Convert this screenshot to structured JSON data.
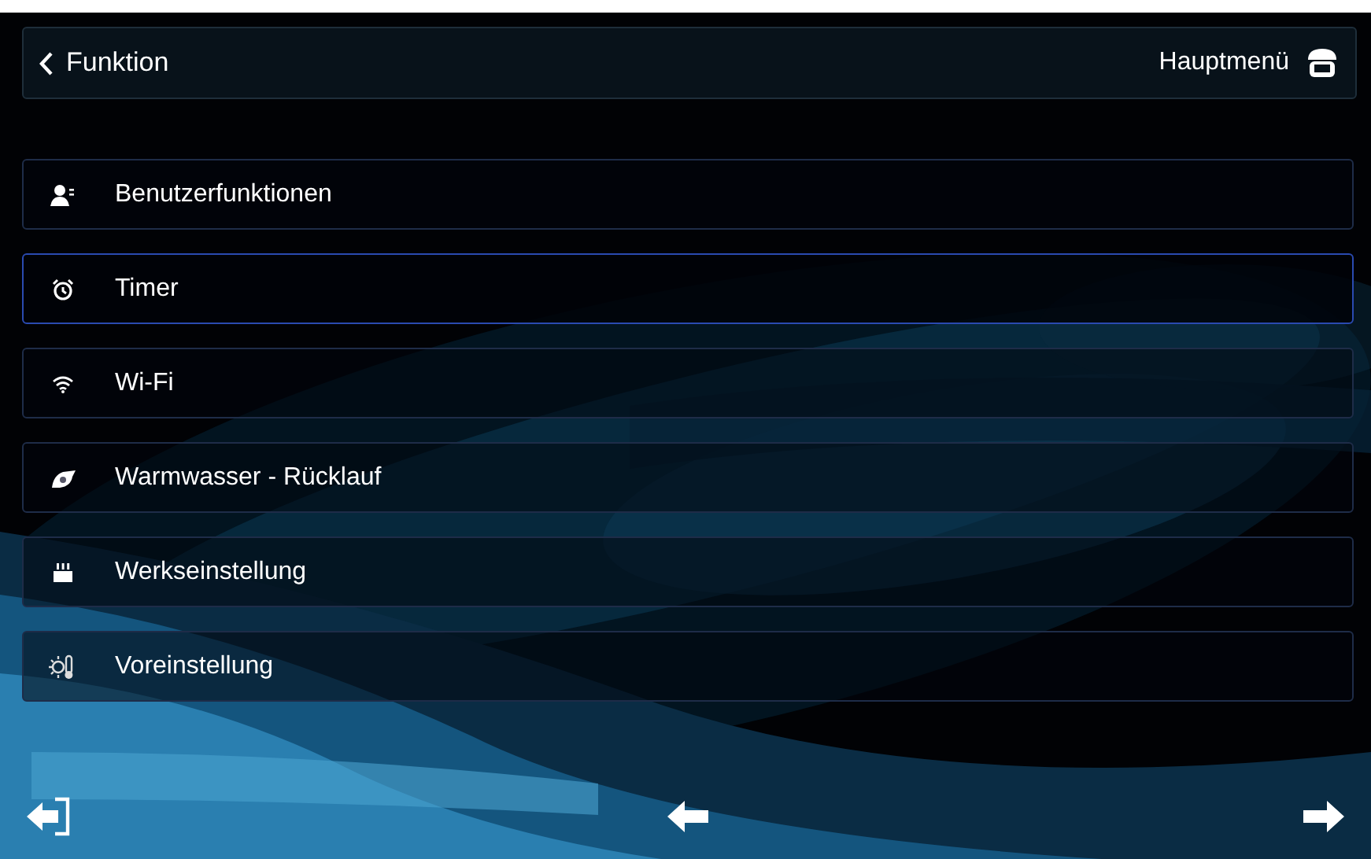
{
  "header": {
    "back_label": "Funktion",
    "home_label": "Hauptmenü"
  },
  "menu_items": [
    {
      "label": "Benutzerfunktionen",
      "selected": false
    },
    {
      "label": "Timer",
      "selected": true
    },
    {
      "label": "Wi-Fi",
      "selected": false
    },
    {
      "label": "Warmwasser - Rücklauf",
      "selected": false
    },
    {
      "label": "Werkseinstellung",
      "selected": false
    },
    {
      "label": "Voreinstellung",
      "selected": false
    }
  ]
}
